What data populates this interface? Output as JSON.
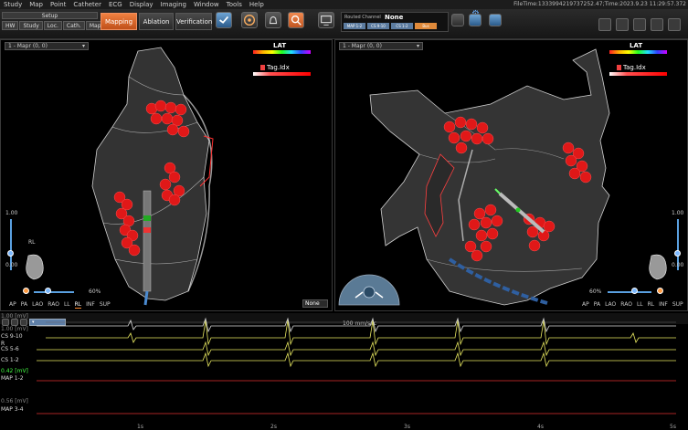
{
  "menu": [
    "Study",
    "Map",
    "Point",
    "Catheter",
    "ECG",
    "Display",
    "Imaging",
    "Window",
    "Tools",
    "Help"
  ],
  "file_time": "FileTime:1333994219737252.47;Time:2023.9.23 11:29:57.372",
  "toolbar": {
    "setup": "Setup",
    "subtabs": [
      "HW",
      "Study",
      "Loc.",
      "Cath.",
      "Map"
    ],
    "mapping": "Mapping",
    "ablation": "Ablation",
    "verification": "Verification",
    "routed_label": "Routed Channel",
    "routed_value": "None",
    "chips": [
      "MAP 1-2",
      "CS 9-10",
      "CS 1-2",
      "Bus"
    ]
  },
  "left_panel": {
    "view": "1 - Mapr (0, 0)",
    "lat": "LAT",
    "tag": "Tag.Idx",
    "scale_top": "1.00",
    "scale_bottom": "0.00",
    "orientation": "RL",
    "zoom": "60%",
    "views": [
      "AP",
      "PA",
      "LAO",
      "RAO",
      "LL",
      "RL",
      "INF",
      "SUP"
    ],
    "selected_view": "RL",
    "none_select": "None"
  },
  "right_panel": {
    "view": "1 - Mapr (0, 0)",
    "lat": "LAT",
    "tag": "Tag.Idx",
    "scale_top": "1.00",
    "scale_bottom": "0.00",
    "zoom": "60%",
    "views": [
      "AP",
      "PA",
      "LAO",
      "RAO",
      "LL",
      "RL",
      "INF",
      "SUP"
    ]
  },
  "ecg": {
    "speed": "100 mm/sec",
    "channels": [
      {
        "label": "1.00 [mV]",
        "type": "scale"
      },
      {
        "label": "R",
        "type": "name"
      },
      {
        "label": "1.00 [mV]",
        "type": "scale"
      },
      {
        "label": "CS 9-10",
        "type": "name"
      },
      {
        "label": "CS 5-6",
        "type": "name"
      },
      {
        "label": "CS 1-2",
        "type": "name"
      },
      {
        "label": "0.42 [mV]",
        "type": "scale"
      },
      {
        "label": "MAP 1-2",
        "type": "name"
      },
      {
        "label": "0.56 [mV]",
        "type": "scale"
      },
      {
        "label": "MAP 3-4",
        "type": "name"
      }
    ],
    "ticks": [
      "1s",
      "2s",
      "3s",
      "4s",
      "5s"
    ]
  }
}
